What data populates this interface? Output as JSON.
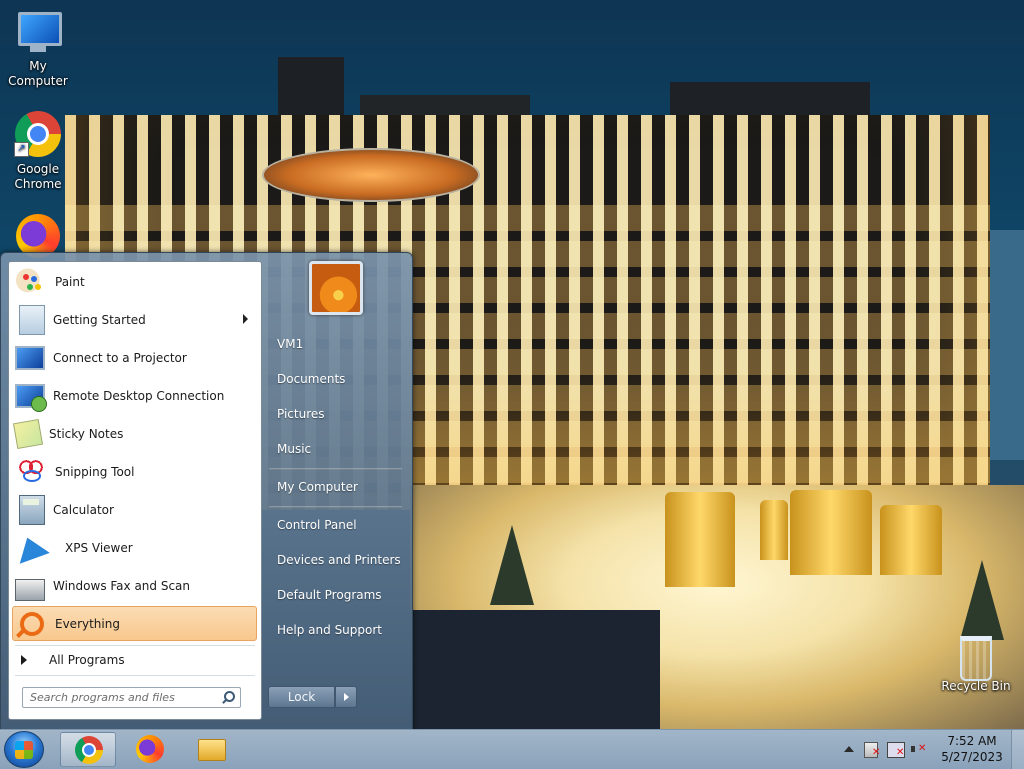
{
  "desktop": {
    "icons": [
      {
        "label": "My Computer",
        "icon": "computer-icon"
      },
      {
        "label": "Google Chrome",
        "icon": "chrome-icon"
      },
      {
        "label": "Firefox",
        "icon": "firefox-icon"
      },
      {
        "label": "Recycle Bin",
        "icon": "recycle-bin-icon"
      }
    ]
  },
  "start_menu": {
    "programs": [
      {
        "label": "Paint",
        "icon": "paint-icon"
      },
      {
        "label": "Getting Started",
        "icon": "getting-started-icon",
        "submenu": true
      },
      {
        "label": "Connect to a Projector",
        "icon": "projector-icon"
      },
      {
        "label": "Remote Desktop Connection",
        "icon": "remote-desktop-icon"
      },
      {
        "label": "Sticky Notes",
        "icon": "sticky-notes-icon"
      },
      {
        "label": "Snipping Tool",
        "icon": "snipping-tool-icon"
      },
      {
        "label": "Calculator",
        "icon": "calculator-icon"
      },
      {
        "label": "XPS Viewer",
        "icon": "xps-viewer-icon"
      },
      {
        "label": "Windows Fax and Scan",
        "icon": "fax-scan-icon"
      },
      {
        "label": "Everything",
        "icon": "everything-icon",
        "highlighted": true
      }
    ],
    "all_programs": "All Programs",
    "search_placeholder": "Search programs and files",
    "right_items": [
      {
        "label": "VM1"
      },
      {
        "label": "Documents"
      },
      {
        "label": "Pictures"
      },
      {
        "label": "Music"
      },
      {
        "label": "My Computer"
      },
      {
        "label": "Control Panel"
      },
      {
        "label": "Devices and Printers"
      },
      {
        "label": "Default Programs"
      },
      {
        "label": "Help and Support"
      }
    ],
    "lock_label": "Lock",
    "highlight_color": "#f8c88d"
  },
  "taskbar": {
    "pinned": [
      {
        "name": "Google Chrome",
        "icon": "chrome-icon",
        "active": true
      },
      {
        "name": "Firefox",
        "icon": "firefox-icon"
      },
      {
        "name": "File Explorer",
        "icon": "folder-icon"
      }
    ],
    "clock": {
      "time": "7:52 AM",
      "date": "5/27/2023"
    }
  }
}
